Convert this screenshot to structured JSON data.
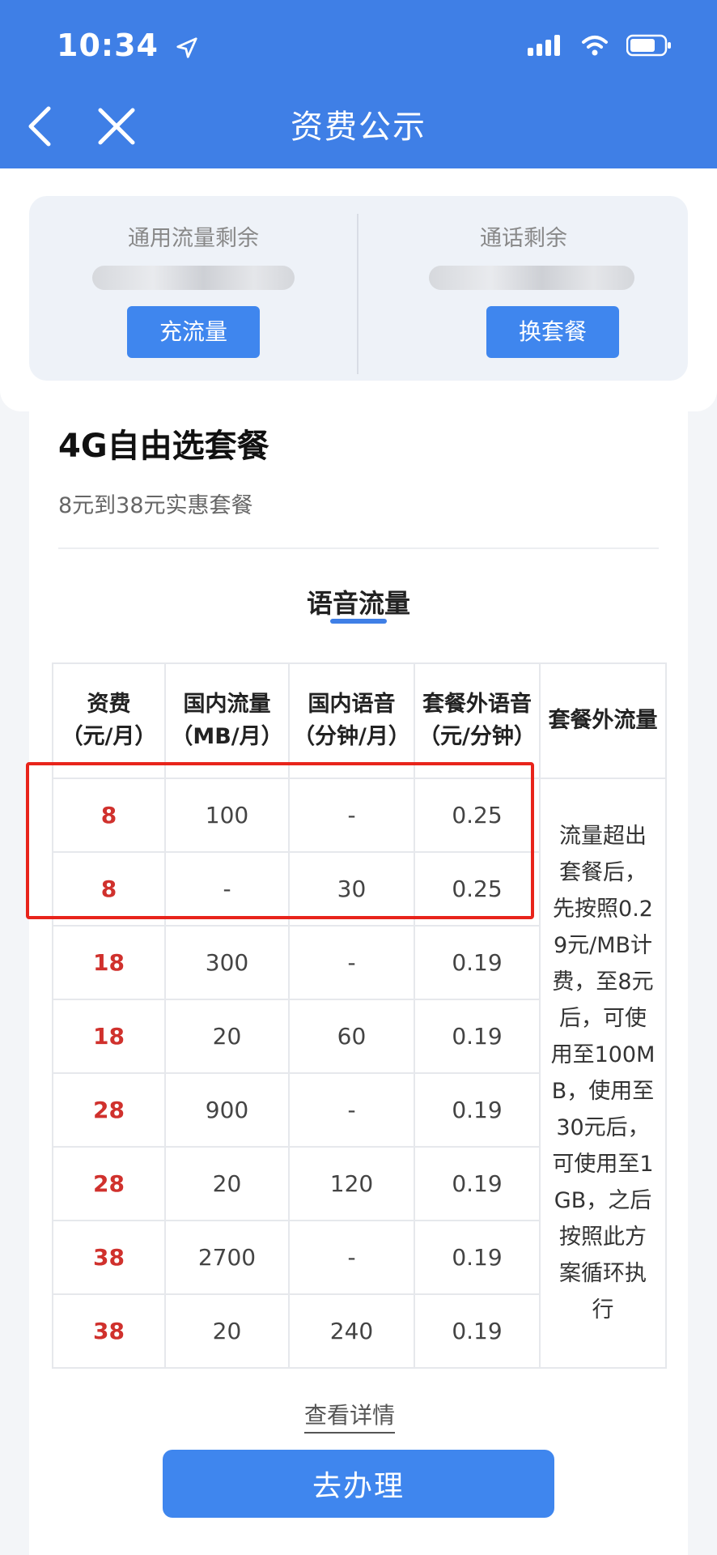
{
  "status_bar": {
    "time": "10:34"
  },
  "nav": {
    "title": "资费公示"
  },
  "summary": {
    "left": {
      "label": "通用流量剩余",
      "button": "充流量"
    },
    "right": {
      "label": "通话剩余",
      "button": "换套餐"
    }
  },
  "plan": {
    "name": "4G自由选套餐",
    "subtitle": "8元到38元实惠套餐"
  },
  "tab": {
    "label": "语音流量"
  },
  "table": {
    "headers": [
      [
        "资费",
        "（元/月）"
      ],
      [
        "国内流量",
        "（MB/月）"
      ],
      [
        "国内语音",
        "（分钟/月）"
      ],
      [
        "套餐外语音",
        "（元/分钟）"
      ],
      [
        "套餐外流量"
      ]
    ],
    "rows": [
      [
        "8",
        "100",
        "-",
        "0.25"
      ],
      [
        "8",
        "-",
        "30",
        "0.25"
      ],
      [
        "18",
        "300",
        "-",
        "0.19"
      ],
      [
        "18",
        "20",
        "60",
        "0.19"
      ],
      [
        "28",
        "900",
        "-",
        "0.19"
      ],
      [
        "28",
        "20",
        "120",
        "0.19"
      ],
      [
        "38",
        "2700",
        "-",
        "0.19"
      ],
      [
        "38",
        "20",
        "240",
        "0.19"
      ]
    ],
    "overage_note_lines": [
      "流量超出",
      "套餐后，",
      "先按照0.2",
      "9元/MB计",
      "费，至8元",
      "后，可使",
      "用至100M",
      "B，使用至",
      "30元后，",
      "可使用至1",
      "GB，之后",
      "按照此方",
      "案循环执",
      "行"
    ]
  },
  "footer": {
    "details_link": "查看详情",
    "action_button": "去办理"
  },
  "colors": {
    "brand_blue": "#3f7fe6",
    "price_red": "#d0312d",
    "highlight_red": "#e8241b"
  }
}
